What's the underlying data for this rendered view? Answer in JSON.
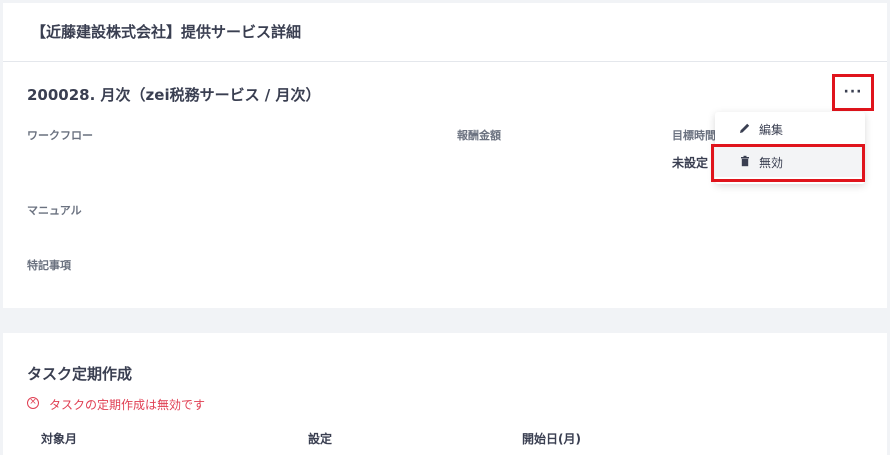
{
  "header": {
    "title": "【近藤建設株式会社】提供サービス詳細"
  },
  "service": {
    "title": "200028. 月次（zei税務サービス / 月次）",
    "labels": {
      "workflow": "ワークフロー",
      "fee": "報酬金額",
      "target_time": "目標時間",
      "manual": "マニュアル",
      "notes": "特記事項"
    },
    "target_time_value": "未設定",
    "more_icon": "ellipsis-icon",
    "more_label": "···"
  },
  "menu": {
    "items": [
      {
        "label": "編集",
        "icon": "pencil-icon"
      },
      {
        "label": "無効",
        "icon": "trash-icon"
      }
    ]
  },
  "task": {
    "title": "タスク定期作成",
    "error_icon": "circle-x-icon",
    "error_glyph": "×",
    "error": "タスクの定期作成は無効です",
    "columns": [
      "対象月",
      "設定",
      "開始日(月)"
    ]
  },
  "colors": {
    "accent_red": "#e0141c",
    "error": "#e03e52",
    "text": "#3a3f51"
  }
}
